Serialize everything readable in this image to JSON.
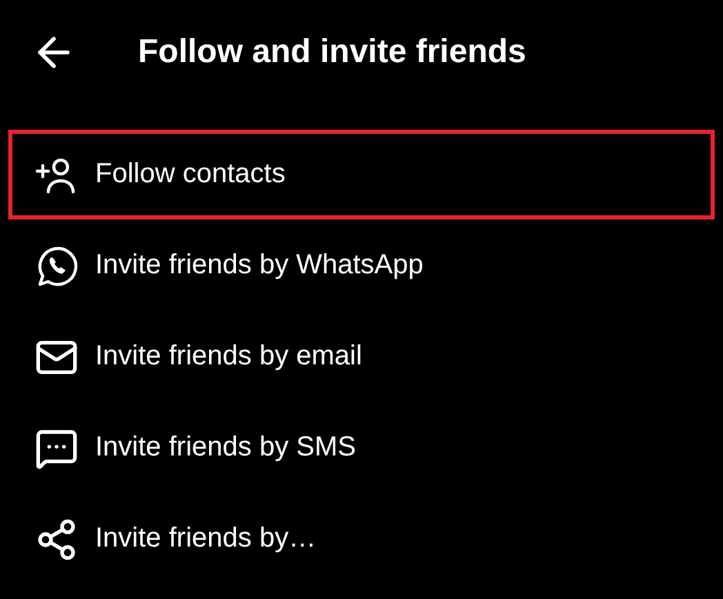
{
  "header": {
    "title": "Follow and invite friends"
  },
  "items": [
    {
      "kind": "follow",
      "label": "Follow contacts",
      "highlighted": true
    },
    {
      "kind": "whatsapp",
      "label": "Invite friends by WhatsApp",
      "highlighted": false
    },
    {
      "kind": "email",
      "label": "Invite friends by email",
      "highlighted": false
    },
    {
      "kind": "sms",
      "label": "Invite friends by SMS",
      "highlighted": false
    },
    {
      "kind": "share",
      "label": "Invite friends by…",
      "highlighted": false
    }
  ]
}
